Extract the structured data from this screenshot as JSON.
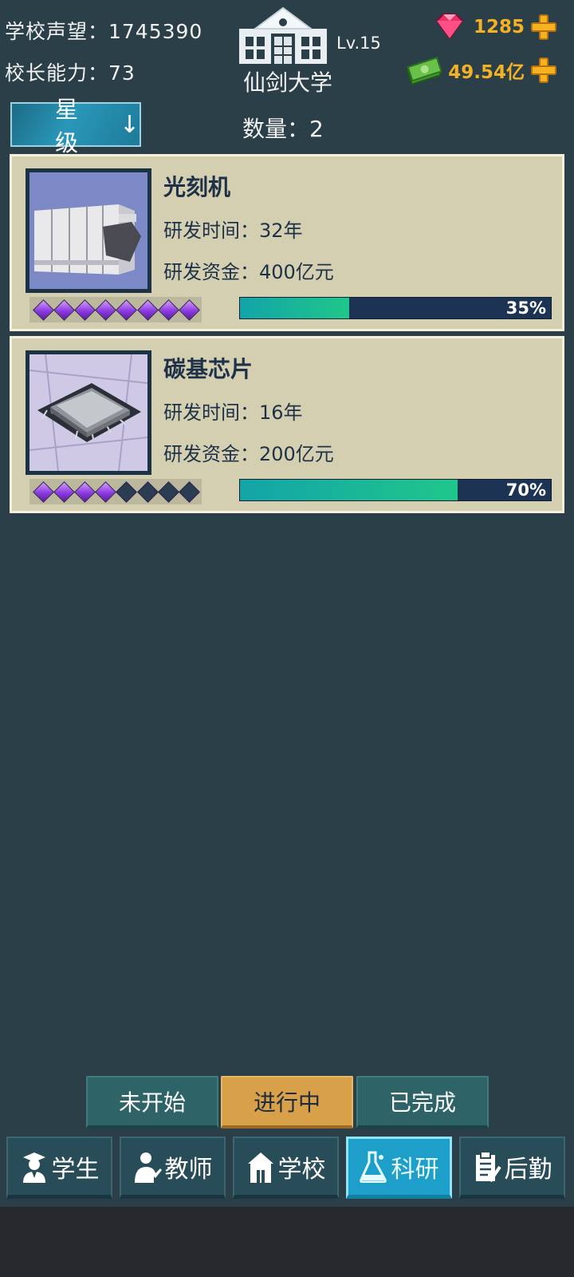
{
  "header": {
    "reputation": "学校声望：1745390",
    "principal_ability": "校长能力：73",
    "school_name": "仙剑大学",
    "school_level": "Lv.15",
    "gems": "1285",
    "money": "49.54亿"
  },
  "toolbar": {
    "sort_label": "星级",
    "sort_arrow": "↓",
    "count": "数量：2"
  },
  "research_items": [
    {
      "name": "光刻机",
      "time": "研发时间：32年",
      "funds": "研发资金：400亿元",
      "stars_filled": 8,
      "stars_total": 8,
      "progress": 0.35,
      "progress_label": "35%",
      "image_icon": "lithography-machine-image"
    },
    {
      "name": "碳基芯片",
      "time": "研发时间：16年",
      "funds": "研发资金：200亿元",
      "stars_filled": 4,
      "stars_total": 8,
      "progress": 0.7,
      "progress_label": "70%",
      "image_icon": "carbon-chip-image"
    }
  ],
  "status_tabs": [
    {
      "label": "未开始",
      "active": false
    },
    {
      "label": "进行中",
      "active": true
    },
    {
      "label": "已完成",
      "active": false
    }
  ],
  "nav": [
    {
      "label": "学生",
      "icon": "student-icon",
      "active": false
    },
    {
      "label": "教师",
      "icon": "teacher-icon",
      "active": false
    },
    {
      "label": "学校",
      "icon": "school-icon",
      "active": false
    },
    {
      "label": "科研",
      "icon": "flask-icon",
      "active": true
    },
    {
      "label": "后勤",
      "icon": "clipboard-icon",
      "active": false
    }
  ],
  "colors": {
    "background": "#2a3f48",
    "card": "#d3cfb0",
    "accent_gold": "#f3b224",
    "progress_fill": "#1fc78a",
    "active_nav": "#1d9fc9"
  }
}
